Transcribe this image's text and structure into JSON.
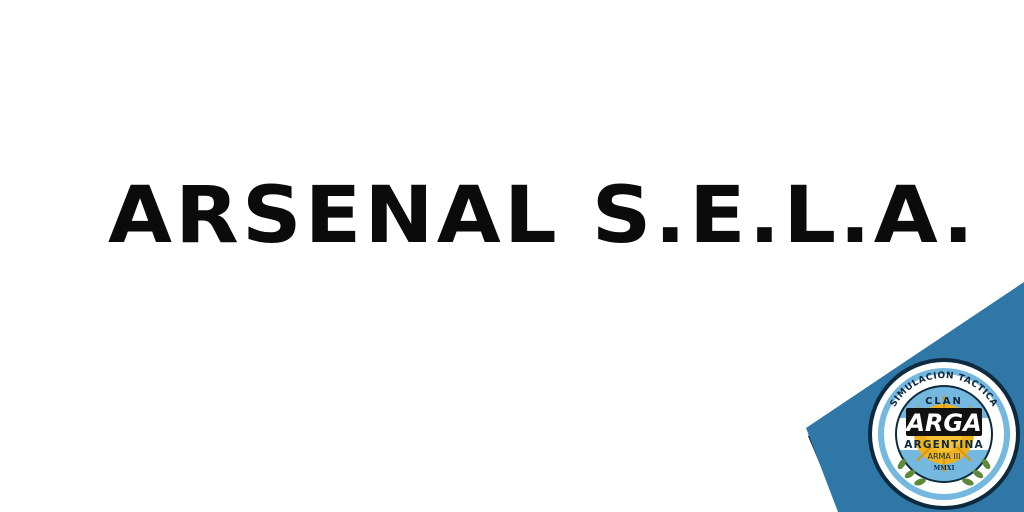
{
  "title": "ARSENAL S.E.L.A.",
  "badge": {
    "ring_text": "SIMULACION TACTICA",
    "clan_label": "CLAN",
    "logo_text": "ARGA",
    "country_label": "ARGENTINA",
    "game_label": "ARMA III",
    "year_label": "MMXI"
  },
  "colors": {
    "background": "#ffffff",
    "title": "#0b0b0b",
    "band_blue": "#2e77a6",
    "band_shadow": "#101010",
    "badge_sky": "#74b7df",
    "badge_sun": "#f0b21c"
  }
}
